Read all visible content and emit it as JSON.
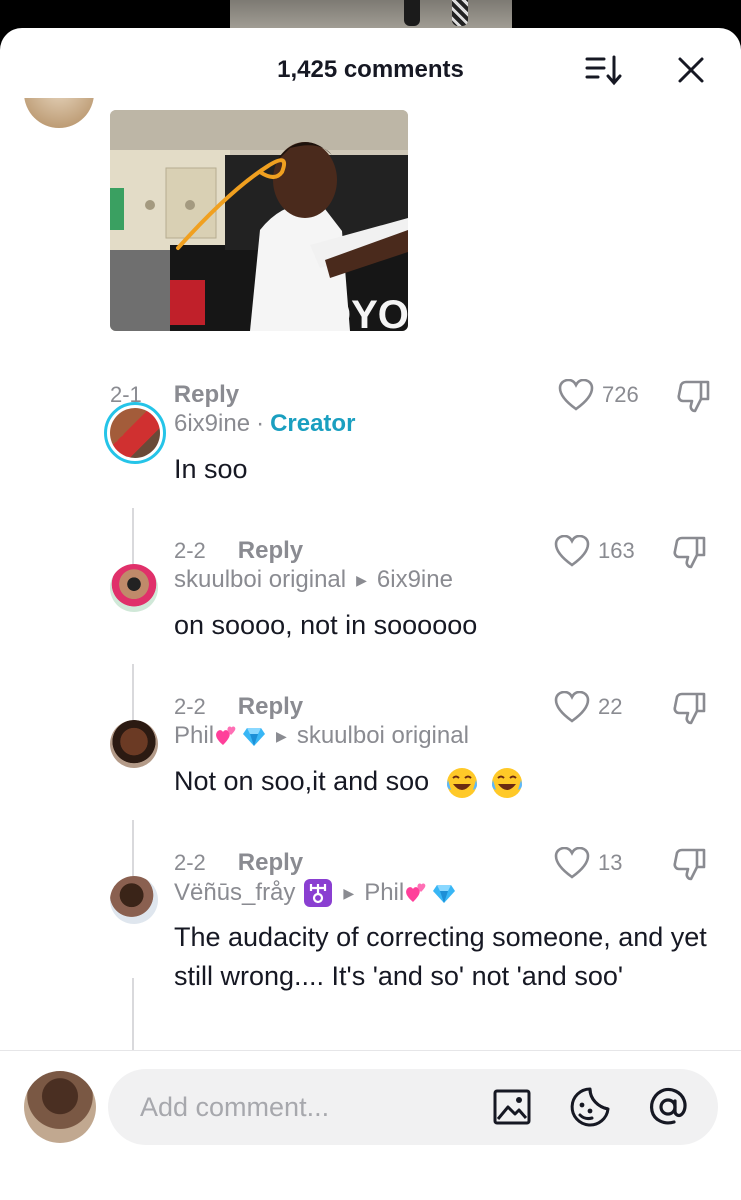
{
  "header": {
    "title": "1,425 comments"
  },
  "icons": {
    "sort": "sort-icon",
    "close": "close-icon",
    "like": "heart-icon",
    "dislike": "thumbs-down-icon",
    "image": "image-icon",
    "emoji": "emoji-icon",
    "mention": "at-icon"
  },
  "comments": [
    {
      "date": "2-1",
      "reply": "Reply",
      "likes": "726"
    },
    {
      "user": "6ix9ine",
      "sep": "·",
      "badge": "Creator",
      "text": "In soo",
      "date": "2-2",
      "reply": "Reply",
      "likes": "163"
    },
    {
      "user": "skuulboi original",
      "reply_to": "6ix9ine",
      "text": "on soooo, not in soooooo",
      "date": "2-2",
      "reply": "Reply",
      "likes": "22"
    },
    {
      "user": "Phil",
      "reply_to": "skuulboi original",
      "text": "Not on soo,it and soo",
      "date": "2-2",
      "reply": "Reply",
      "likes": "13"
    },
    {
      "user": "Vëñūs_fråy",
      "reply_to": "Phil",
      "text": "The audacity of correcting someone, and yet still wrong.... It's 'and so' not 'and soo'"
    }
  ],
  "gif_overlay_text": "OYO",
  "footer": {
    "placeholder": "Add comment..."
  },
  "colors": {
    "creator": "#1a9fc0",
    "muted": "#8a8b91",
    "text": "#161823",
    "input_bg": "#f1f1f2"
  }
}
